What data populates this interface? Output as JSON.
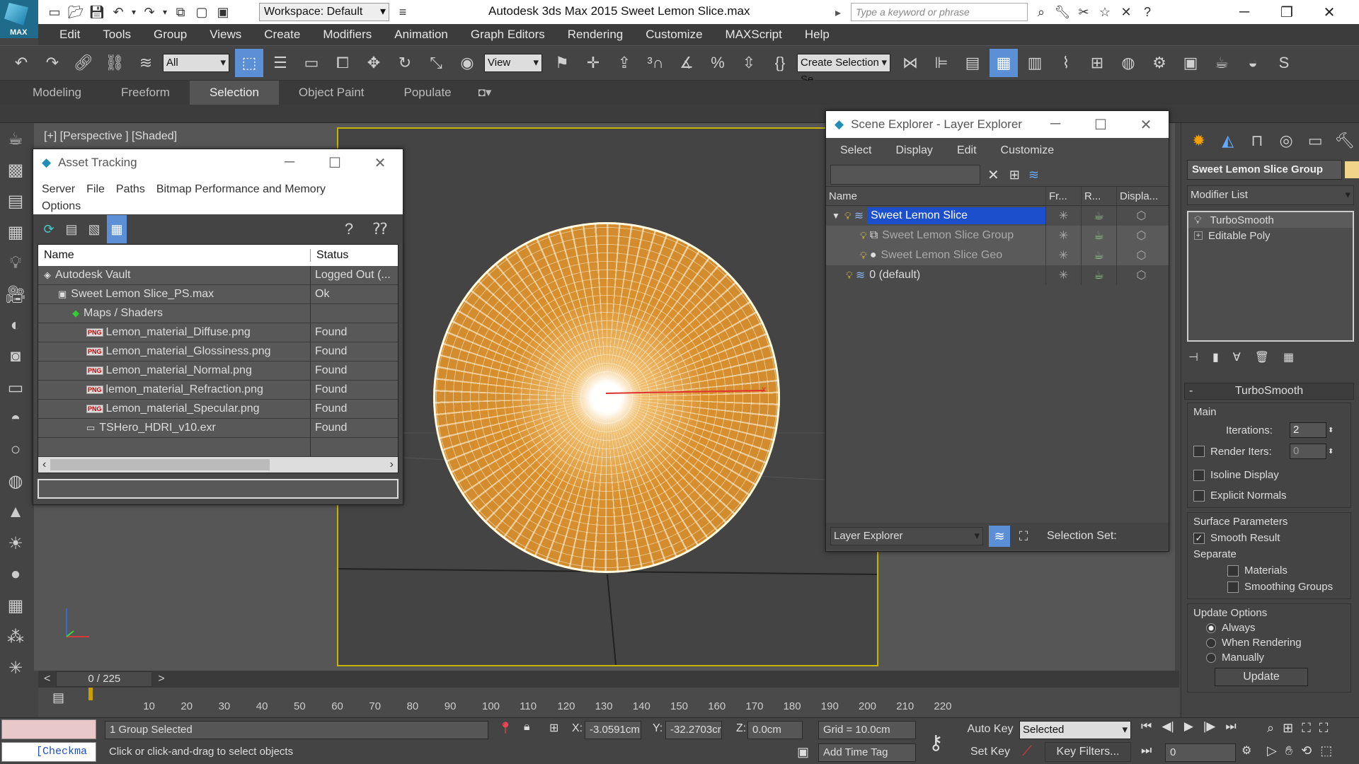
{
  "app": {
    "logo_text": "MAX",
    "workspace": "Workspace: Default",
    "title": "Autodesk 3ds Max  2015     Sweet Lemon Slice.max",
    "search_placeholder": "Type a keyword or phrase"
  },
  "menus": [
    "Edit",
    "Tools",
    "Group",
    "Views",
    "Create",
    "Modifiers",
    "Animation",
    "Graph Editors",
    "Rendering",
    "Customize",
    "MAXScript",
    "Help"
  ],
  "toolbar": {
    "selection_filter": "All",
    "ref_coord": "View",
    "selection_set": "Create Selection Se"
  },
  "ribbon": {
    "tabs": [
      "Modeling",
      "Freeform",
      "Selection",
      "Object Paint",
      "Populate"
    ],
    "active": "Selection"
  },
  "viewport": {
    "label": "[+] [Perspective ] [Shaded]"
  },
  "asset_tracking": {
    "title": "Asset Tracking",
    "menu": [
      "Server",
      "File",
      "Paths",
      "Bitmap Performance and Memory",
      "Options"
    ],
    "columns": [
      "Name",
      "Status"
    ],
    "rows": [
      {
        "name": "Autodesk Vault",
        "status": "Logged Out (...",
        "indent": 0,
        "icon": "vault-icon"
      },
      {
        "name": "Sweet Lemon Slice_PS.max",
        "status": "Ok",
        "indent": 1,
        "icon": "max-file-icon"
      },
      {
        "name": "Maps / Shaders",
        "status": "",
        "indent": 2,
        "icon": "maps-icon"
      },
      {
        "name": "Lemon_material_Diffuse.png",
        "status": "Found",
        "indent": 3,
        "icon": "png-icon"
      },
      {
        "name": "Lemon_material_Glossiness.png",
        "status": "Found",
        "indent": 3,
        "icon": "png-icon"
      },
      {
        "name": "Lemon_material_Normal.png",
        "status": "Found",
        "indent": 3,
        "icon": "png-icon"
      },
      {
        "name": "lemon_material_Refraction.png",
        "status": "Found",
        "indent": 3,
        "icon": "png-icon"
      },
      {
        "name": "Lemon_material_Specular.png",
        "status": "Found",
        "indent": 3,
        "icon": "png-icon"
      },
      {
        "name": "TSHero_HDRI_v10.exr",
        "status": "Found",
        "indent": 3,
        "icon": "exr-icon"
      }
    ]
  },
  "scene_explorer": {
    "title": "Scene Explorer - Layer Explorer",
    "menu": [
      "Select",
      "Display",
      "Edit",
      "Customize"
    ],
    "columns": [
      "Name",
      "Fr...",
      "R...",
      "Displa..."
    ],
    "rows": [
      {
        "name": "Sweet Lemon Slice",
        "selected": true,
        "dim": false
      },
      {
        "name": "Sweet Lemon Slice Group",
        "selected": false,
        "dim": true
      },
      {
        "name": "Sweet Lemon Slice Geo",
        "selected": false,
        "dim": true
      },
      {
        "name": "0 (default)",
        "selected": false,
        "dim": false
      }
    ],
    "footer_mode": "Layer Explorer",
    "footer_selset": "Selection Set:"
  },
  "command_panel": {
    "object_name": "Sweet Lemon Slice Group",
    "modifier_list": "Modifier List",
    "stack": [
      "TurboSmooth",
      "Editable Poly"
    ],
    "rollout_title": "TurboSmooth",
    "main_group": "Main",
    "iterations_label": "Iterations:",
    "iterations": "2",
    "render_iters_label": "Render Iters:",
    "render_iters": "0",
    "isoline": "Isoline Display",
    "explicit_normals": "Explicit Normals",
    "surface_group": "Surface Parameters",
    "smooth_result": "Smooth Result",
    "separate": "Separate",
    "materials": "Materials",
    "smoothing_groups": "Smoothing Groups",
    "update_group": "Update Options",
    "update_options": [
      "Always",
      "When Rendering",
      "Manually"
    ],
    "update_button": "Update"
  },
  "timeline": {
    "frame_display": "0 / 225",
    "ticks": [
      "10",
      "20",
      "30",
      "40",
      "50",
      "60",
      "70",
      "80",
      "90",
      "100",
      "110",
      "120",
      "130",
      "140",
      "150",
      "160",
      "170",
      "180",
      "190",
      "200",
      "210",
      "220"
    ]
  },
  "status": {
    "script_label": "[Checkma",
    "selected_text": "1 Group Selected",
    "prompt": "Click or click-and-drag to select objects",
    "x_label": "X:",
    "x": "-3.0591cm",
    "y_label": "Y:",
    "y": "-32.2703cr",
    "z_label": "Z:",
    "z": "0.0cm",
    "grid": "Grid = 10.0cm",
    "add_time_tag": "Add Time Tag",
    "auto_key": "Auto Key",
    "set_key": "Set Key",
    "key_mode": "Selected",
    "key_filters": "Key Filters...",
    "frame": "0"
  }
}
